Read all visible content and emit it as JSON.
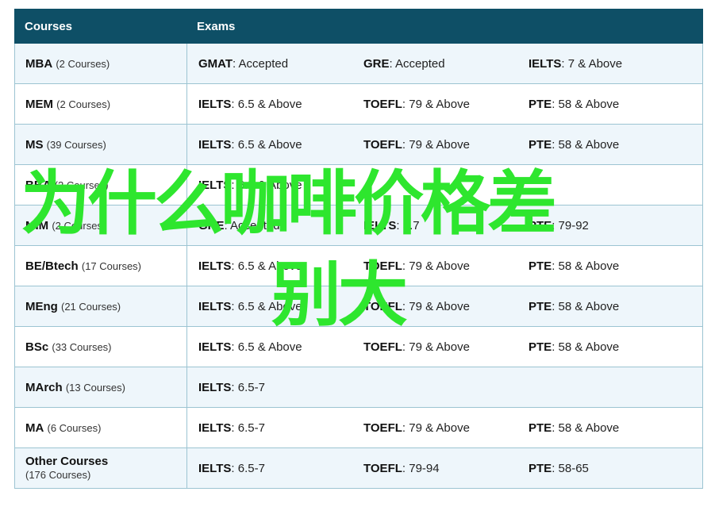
{
  "header": {
    "courses": "Courses",
    "exams": "Exams"
  },
  "rows": [
    {
      "name": "MBA",
      "count": "(2 Courses)",
      "exams": [
        {
          "n": "GMAT",
          "v": ": Accepted"
        },
        {
          "n": "GRE",
          "v": ": Accepted"
        },
        {
          "n": "IELTS",
          "v": ": 7 & Above"
        }
      ]
    },
    {
      "name": "MEM",
      "count": "(2 Courses)",
      "exams": [
        {
          "n": "IELTS",
          "v": ": 6.5 & Above"
        },
        {
          "n": "TOEFL",
          "v": ": 79 & Above"
        },
        {
          "n": "PTE",
          "v": ": 58 & Above"
        }
      ]
    },
    {
      "name": "MS",
      "count": "(39 Courses)",
      "exams": [
        {
          "n": "IELTS",
          "v": ": 6.5 & Above"
        },
        {
          "n": "TOEFL",
          "v": ": 79 & Above"
        },
        {
          "n": "PTE",
          "v": ": 58 & Above"
        }
      ]
    },
    {
      "name": "BBA",
      "count": "(2 Courses)",
      "exams": [
        {
          "n": "IELTS",
          "v": ": 6.5 & Above"
        },
        {
          "n": "",
          "v": ""
        },
        {
          "n": "",
          "v": ""
        }
      ]
    },
    {
      "name": "MIM",
      "count": "(2 Courses)",
      "exams": [
        {
          "n": "GRE",
          "v": ": Accepted"
        },
        {
          "n": "IELTS",
          "v": ": 5.7"
        },
        {
          "n": "PTE",
          "v": ": 79-92"
        }
      ]
    },
    {
      "name": "BE/Btech",
      "count": "(17 Courses)",
      "exams": [
        {
          "n": "IELTS",
          "v": ": 6.5 & Above"
        },
        {
          "n": "TOEFL",
          "v": ": 79 & Above"
        },
        {
          "n": "PTE",
          "v": ": 58 & Above"
        }
      ]
    },
    {
      "name": "MEng",
      "count": "(21 Courses)",
      "exams": [
        {
          "n": "IELTS",
          "v": ": 6.5 & Above"
        },
        {
          "n": "TOEFL",
          "v": ": 79 & Above"
        },
        {
          "n": "PTE",
          "v": ": 58 & Above"
        }
      ]
    },
    {
      "name": "BSc",
      "count": "(33 Courses)",
      "exams": [
        {
          "n": "IELTS",
          "v": ": 6.5 & Above"
        },
        {
          "n": "TOEFL",
          "v": ": 79 & Above"
        },
        {
          "n": "PTE",
          "v": ": 58 & Above"
        }
      ]
    },
    {
      "name": "MArch",
      "count": "(13 Courses)",
      "exams": [
        {
          "n": "IELTS",
          "v": ": 6.5-7"
        }
      ]
    },
    {
      "name": "MA",
      "count": "(6 Courses)",
      "exams": [
        {
          "n": "IELTS",
          "v": ": 6.5-7"
        },
        {
          "n": "TOEFL",
          "v": ": 79 & Above"
        },
        {
          "n": "PTE",
          "v": ": 58 & Above"
        }
      ]
    },
    {
      "name": "Other Courses",
      "count": "(176 Courses)",
      "exams": [
        {
          "n": "IELTS",
          "v": ": 6.5-7"
        },
        {
          "n": "TOEFL",
          "v": ": 79-94"
        },
        {
          "n": "PTE",
          "v": ": 58-65"
        }
      ]
    }
  ],
  "overlay": {
    "line1": "为什么咖啡价格差",
    "line2": "别大"
  },
  "colors": {
    "header_bg": "#0e4f66",
    "overlay_text": "#2ee62e",
    "row_alt": "#eef6fb"
  }
}
